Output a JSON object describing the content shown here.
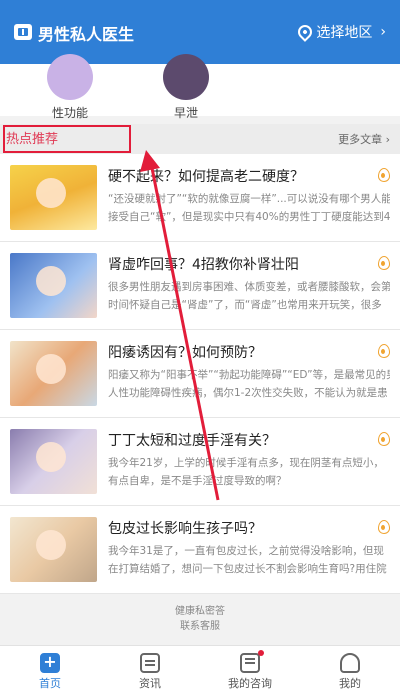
{
  "app": {
    "title": "男性私人医生",
    "region_label": "选择地区",
    "brand_icon": "medical-kit-icon",
    "accent": "#2f7fd6"
  },
  "categories": [
    {
      "label": "性功能"
    },
    {
      "label": "早泄"
    }
  ],
  "hot_section": {
    "title": "热点推荐",
    "more_label": "更多文章",
    "highlight_color": "#e21d3a"
  },
  "articles": [
    {
      "title": "硬不起来？如何提高老二硬度？",
      "line1": "“还没硬就射了”“软的就像豆腐一样”...可以说没有哪个男人能",
      "line2": "接受自己“软”，但是现实中只有40%的男性丁丁硬度能达到4"
    },
    {
      "title": "肾虚咋回事？4招教你补肾壮阳",
      "line1": "很多男性朋友遇到房事困难、体质变差，或者腰膝酸软，会第一",
      "line2": "时间怀疑自己是“肾虚”了，而“肾虚”也常用来开玩笑，很多"
    },
    {
      "title": "阳痿诱因有？如何预防？",
      "line1": "阳痿又称为“阳事不举”“勃起功能障碍”“ED”等，是最常见的男",
      "line2": "人性功能障碍性疾病，偶尔1-2次性交失败，不能认为就是患"
    },
    {
      "title": "丁丁太短和过度手淫有关？",
      "line1": "我今年21岁，上学的时候手淫有点多，现在阴茎有点短小，",
      "line2": "有点自卑，是不是手淫过度导致的啊？"
    },
    {
      "title": "包皮过长影响生孩子吗？",
      "line1": "我今年31是了，一直有包皮过长，之前觉得没啥影响，但现",
      "line2": "在打算结婚了，想问一下包皮过长不割会影响生育吗?用住院"
    }
  ],
  "footer_links": [
    "健康私密答",
    "联系客服"
  ],
  "tabs": [
    {
      "label": "首页",
      "icon": "home-plus-icon",
      "active": true
    },
    {
      "label": "资讯",
      "icon": "news-card-icon",
      "active": false
    },
    {
      "label": "我的咨询",
      "icon": "consult-message-icon",
      "active": false,
      "badge": true
    },
    {
      "label": "我的",
      "icon": "profile-user-icon",
      "active": false
    }
  ]
}
